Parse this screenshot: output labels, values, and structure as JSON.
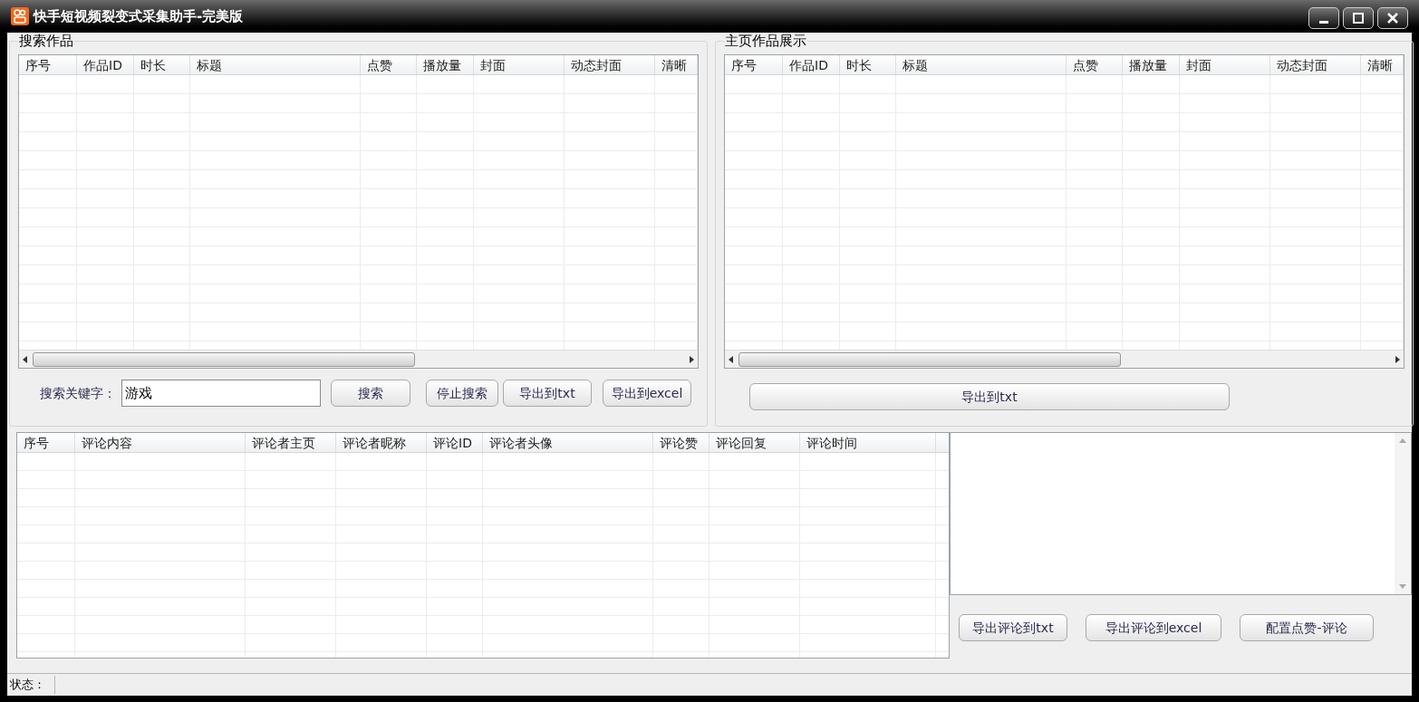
{
  "window": {
    "title": "快手短视频裂变式采集助手-完美版"
  },
  "search_panel": {
    "title": "搜索作品",
    "columns": [
      "序号",
      "作品ID",
      "时长",
      "标题",
      "点赞",
      "播放量",
      "封面",
      "动态封面",
      "清晰"
    ],
    "keyword_label": "搜索关键字：",
    "keyword_value": "游戏",
    "buttons": [
      "搜索",
      "停止搜索",
      "导出到txt",
      "导出到excel"
    ]
  },
  "home_panel": {
    "title": "主页作品展示",
    "columns": [
      "序号",
      "作品ID",
      "时长",
      "标题",
      "点赞",
      "播放量",
      "封面",
      "动态封面",
      "清晰"
    ],
    "buttons": [
      "导出到txt"
    ]
  },
  "comments": {
    "columns": [
      "序号",
      "评论内容",
      "评论者主页",
      "评论者昵称",
      "评论ID",
      "评论者头像",
      "评论赞",
      "评论回复",
      "评论时间"
    ],
    "buttons": [
      "导出评论到txt",
      "导出评论到excel",
      "配置点赞-评论"
    ]
  },
  "status_bar": {
    "label": "状态："
  }
}
